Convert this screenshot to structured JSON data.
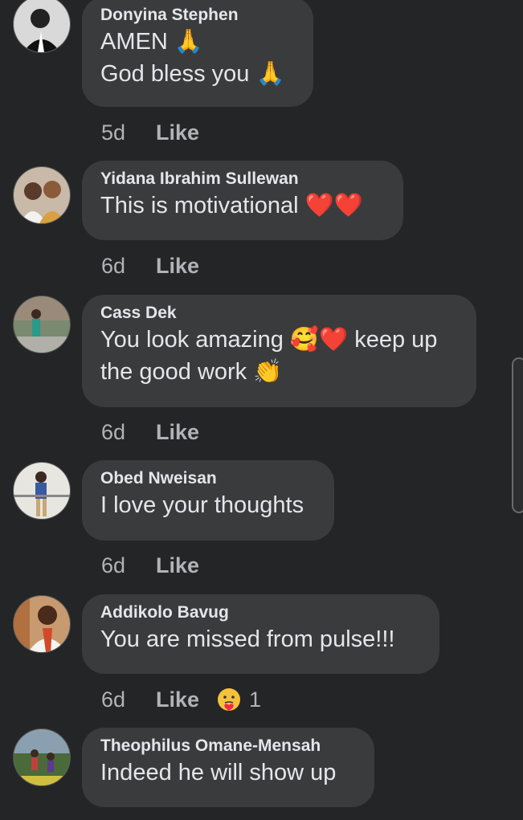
{
  "comments": [
    {
      "name": "Donyina Stephen",
      "lines": [
        "AMEN 🙏",
        "God bless you 🙏"
      ],
      "time": "5d",
      "like": "Like"
    },
    {
      "name": "Yidana Ibrahim Sullewan",
      "lines": [
        "This is motivational ❤️❤️"
      ],
      "time": "6d",
      "like": "Like"
    },
    {
      "name": "Cass Dek",
      "lines": [
        "You look amazing 🥰❤️ keep up",
        "the good work 👏"
      ],
      "time": "6d",
      "like": "Like"
    },
    {
      "name": "Obed Nweisan",
      "lines": [
        "I love your thoughts"
      ],
      "time": "6d",
      "like": "Like"
    },
    {
      "name": "Addikolo Bavug",
      "lines": [
        "You are missed from pulse!!!"
      ],
      "time": "6d",
      "like": "Like",
      "reaction": {
        "icon": "care-reaction-icon",
        "count": "1"
      }
    },
    {
      "name": "Theophilus Omane-Mensah",
      "lines": [
        "Indeed he will show up"
      ]
    }
  ],
  "colors": {
    "background": "#242526",
    "bubble": "#3a3b3c",
    "text": "#e4e6eb",
    "meta": "#b0b3b8"
  }
}
